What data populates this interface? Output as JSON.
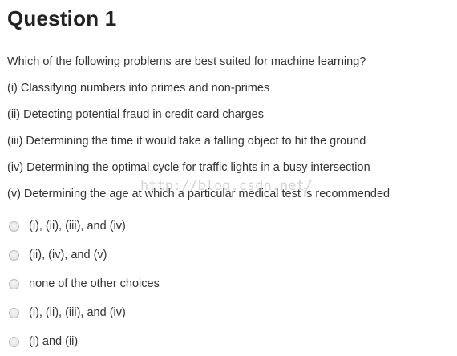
{
  "question": {
    "title": "Question 1",
    "lines": [
      "Which of the following problems are best suited for machine learning?",
      "(i) Classifying numbers into primes and non-primes",
      "(ii) Detecting potential fraud in credit card charges",
      "(iii) Determining the time it would take a falling object to hit the ground",
      "(iv) Determining the optimal cycle for traffic lights in a busy intersection",
      "(v) Determining the age at which a particular medical test is recommended"
    ]
  },
  "choices": [
    {
      "label": "(i), (ii), (iii), and (iv)",
      "selected": false
    },
    {
      "label": "(ii), (iv), and (v)",
      "selected": false
    },
    {
      "label": "none of the other choices",
      "selected": false
    },
    {
      "label": "(i), (ii), (iii), and (iv)",
      "selected": false
    },
    {
      "label": "(i) and (ii)",
      "selected": false
    }
  ],
  "watermark": "http://blog.csdn.net/"
}
